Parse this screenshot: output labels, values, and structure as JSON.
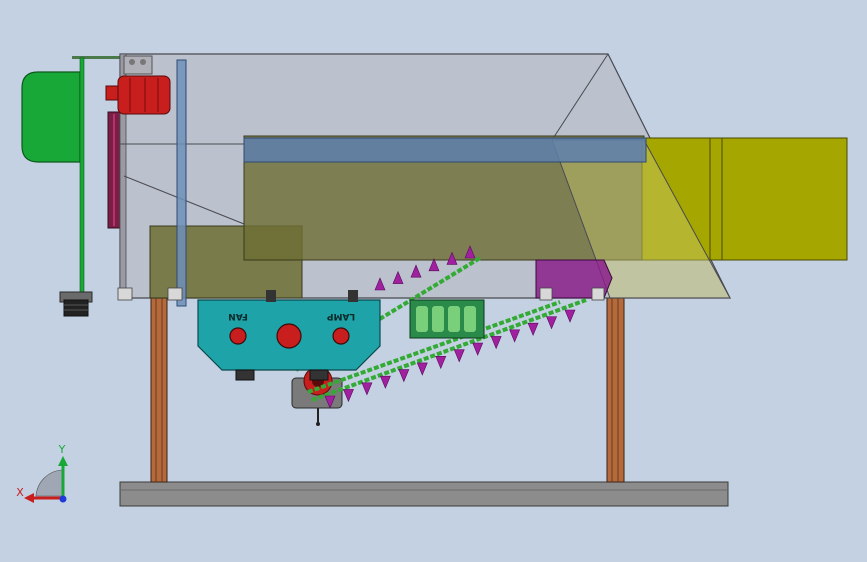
{
  "viewport": {
    "background": "#c3d1e3"
  },
  "panel": {
    "left_label": "FAN",
    "right_label": "LAMP",
    "color": "#1ea3a8",
    "button_color": "#c81e1e"
  },
  "triad": {
    "x_label": "X",
    "y_label": "Y"
  },
  "colors": {
    "motor": "#18a838",
    "hopper_body": "#b4b4bc",
    "trough": "#6e6e34",
    "chute": "#a6a600",
    "legs": "#b56a3c",
    "base": "#8c8c8c",
    "chain": "#33aa33",
    "teeth": "#a020a0",
    "red_parts": "#c81e1e",
    "dark_red_parts": "#7a1e45",
    "blue_bar": "#5d7fae"
  }
}
